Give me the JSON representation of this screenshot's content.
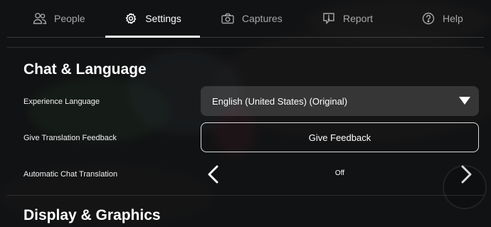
{
  "tabs": [
    {
      "label": "People",
      "icon": "people-icon",
      "active": false
    },
    {
      "label": "Settings",
      "icon": "gear-icon",
      "active": true
    },
    {
      "label": "Captures",
      "icon": "camera-icon",
      "active": false
    },
    {
      "label": "Report",
      "icon": "report-icon",
      "active": false
    },
    {
      "label": "Help",
      "icon": "help-icon",
      "active": false
    }
  ],
  "sections": {
    "chat_language": {
      "title": "Chat & Language",
      "experience_language": {
        "label": "Experience Language",
        "value": "English (United States) (Original)"
      },
      "translation_feedback": {
        "label": "Give Translation Feedback",
        "button": "Give Feedback"
      },
      "auto_translation": {
        "label": "Automatic Chat Translation",
        "value": "Off"
      }
    },
    "display_graphics": {
      "title": "Display & Graphics"
    }
  },
  "colors": {
    "background": "#0e0f10",
    "text": "#ffffff",
    "muted_text": "#9c9c9c",
    "active_indicator": "#ffffff"
  }
}
